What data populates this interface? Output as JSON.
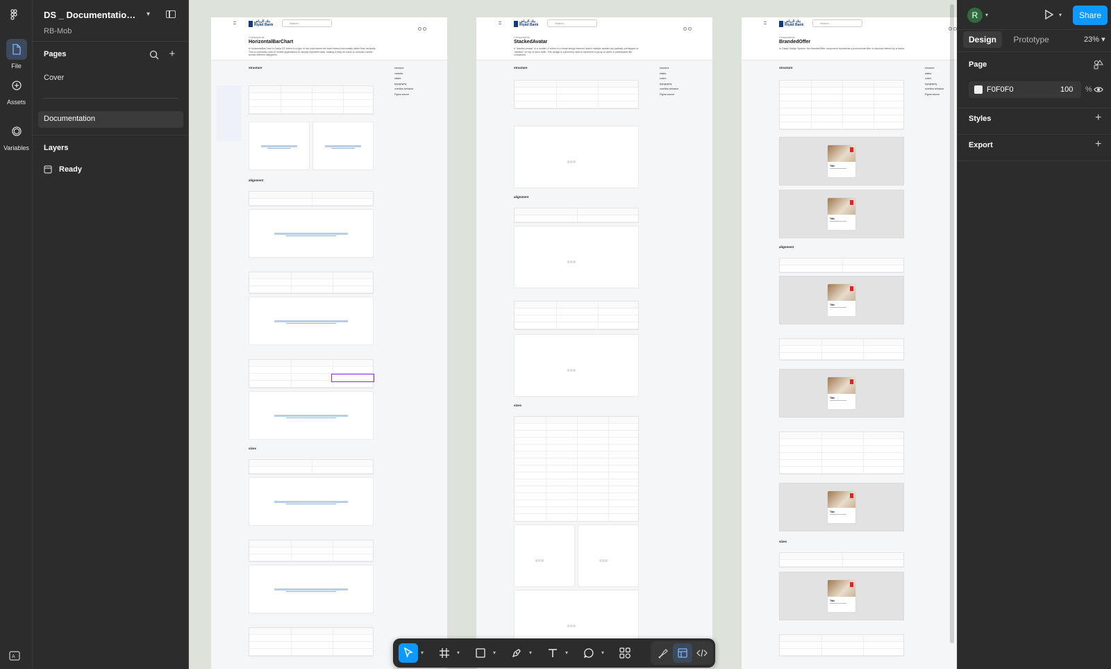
{
  "rail": {
    "items": [
      {
        "label": "File",
        "icon": "file-icon"
      },
      {
        "label": "Assets",
        "icon": "assets-icon"
      },
      {
        "label": "Variables",
        "icon": "variables-icon"
      }
    ]
  },
  "left_panel": {
    "file_title": "DS _ Documentation f...",
    "file_sub": "RB-Mob",
    "pages_title": "Pages",
    "pages": [
      "Cover",
      "Documentation"
    ],
    "selected_page": "Documentation",
    "layers_title": "Layers",
    "layers": [
      {
        "name": "Ready",
        "icon": "section-icon"
      }
    ]
  },
  "canvas": {
    "background": "#dde3da",
    "frames": [
      {
        "brand": "Riyad Bank",
        "brand_ar": "بنك الرياض",
        "search": "Search...",
        "tag": "Components",
        "title": "HorizontalBarChart",
        "desc": "A HorizontalBarChart in Gaaia DS refers to a type of bar chart where the bars extend horizontally rather than vertically. This is commonly used in mobile applications to visually represent data, making it easy for users to compare values across different categories.",
        "toc": [
          "structure",
          "variants",
          "states",
          "typography",
          "overflow behavior",
          "Figma source"
        ],
        "sections": [
          "structure",
          "alignment",
          "sizes"
        ]
      },
      {
        "brand": "Riyad Bank",
        "brand_ar": "بنك الرياض",
        "search": "Search...",
        "tag": "Components",
        "title": "StackedAvatar",
        "desc": "A \"stacked avatar\" in a mobile UI refers to a visual design element where multiple avatars are partially overlapped or \"stacked\" on top of each other. This design is commonly used to represent a group of users or participants like companies.",
        "toc": [
          "structure",
          "states",
          "colors",
          "typography",
          "overflow behavior",
          "Figma source"
        ],
        "sections": [
          "structure",
          "alignment",
          "sizes"
        ]
      },
      {
        "brand": "Riyad Bank",
        "brand_ar": "بنك الرياض",
        "search": "Search...",
        "tag": "Components",
        "title": "BrandedOffer",
        "desc": "In Gaaia Design System, the BrandedOffer component represents a promotional offer or discount offered by a brand.",
        "toc": [
          "structure",
          "states",
          "colors",
          "typography",
          "overflow behavior",
          "Figma source"
        ],
        "sections": [
          "structure",
          "alignment",
          "sizes"
        ],
        "card_title": "Title"
      }
    ]
  },
  "toolbar": {
    "tools": [
      "move-tool",
      "frame-tool",
      "shape-tool",
      "pen-tool",
      "text-tool",
      "comment-tool",
      "actions-tool"
    ],
    "modes": [
      "draw-mode",
      "design-mode",
      "dev-mode"
    ],
    "active_tool": "move-tool"
  },
  "right_panel": {
    "avatar_initial": "R",
    "share_label": "Share",
    "tabs": [
      "Design",
      "Prototype"
    ],
    "active_tab": "Design",
    "zoom": "23%",
    "page_section": "Page",
    "page_color": "F0F0F0",
    "page_opacity": "100",
    "opacity_unit": "%",
    "styles_section": "Styles",
    "export_section": "Export"
  },
  "help_label": "?",
  "colors": {
    "accent": "#0d99ff",
    "panel_bg": "#2c2c2c",
    "highlight": "#8a2be2",
    "badge_red": "#d8262c"
  }
}
